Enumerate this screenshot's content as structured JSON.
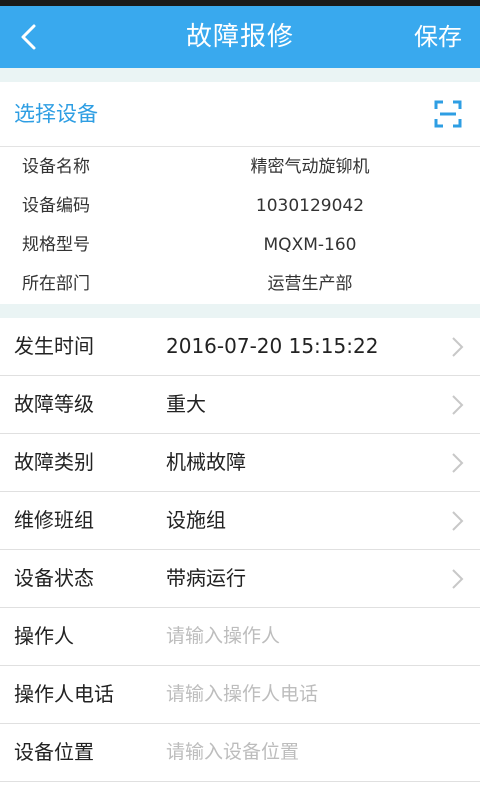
{
  "header": {
    "title": "故障报修",
    "save_label": "保存"
  },
  "select_device": {
    "label": "选择设备"
  },
  "device_info": [
    {
      "label": "设备名称",
      "value": "精密气动旋铆机"
    },
    {
      "label": "设备编码",
      "value": "1030129042"
    },
    {
      "label": "规格型号",
      "value": "MQXM-160"
    },
    {
      "label": "所在部门",
      "value": "运营生产部"
    }
  ],
  "form": {
    "occur_time": {
      "label": "发生时间",
      "value": "2016-07-20 15:15:22"
    },
    "fault_level": {
      "label": "故障等级",
      "value": "重大"
    },
    "fault_type": {
      "label": "故障类别",
      "value": "机械故障"
    },
    "repair_team": {
      "label": "维修班组",
      "value": "设施组"
    },
    "device_status": {
      "label": "设备状态",
      "value": "带病运行"
    },
    "operator": {
      "label": "操作人",
      "placeholder": "请输入操作人"
    },
    "operator_phone": {
      "label": "操作人电话",
      "placeholder": "请输入操作人电话"
    },
    "device_location": {
      "label": "设备位置",
      "placeholder": "请输入设备位置"
    }
  },
  "colors": {
    "appbar": "#39a9ee",
    "accent": "#2e9ee3",
    "placeholder": "#bdbdbd"
  }
}
